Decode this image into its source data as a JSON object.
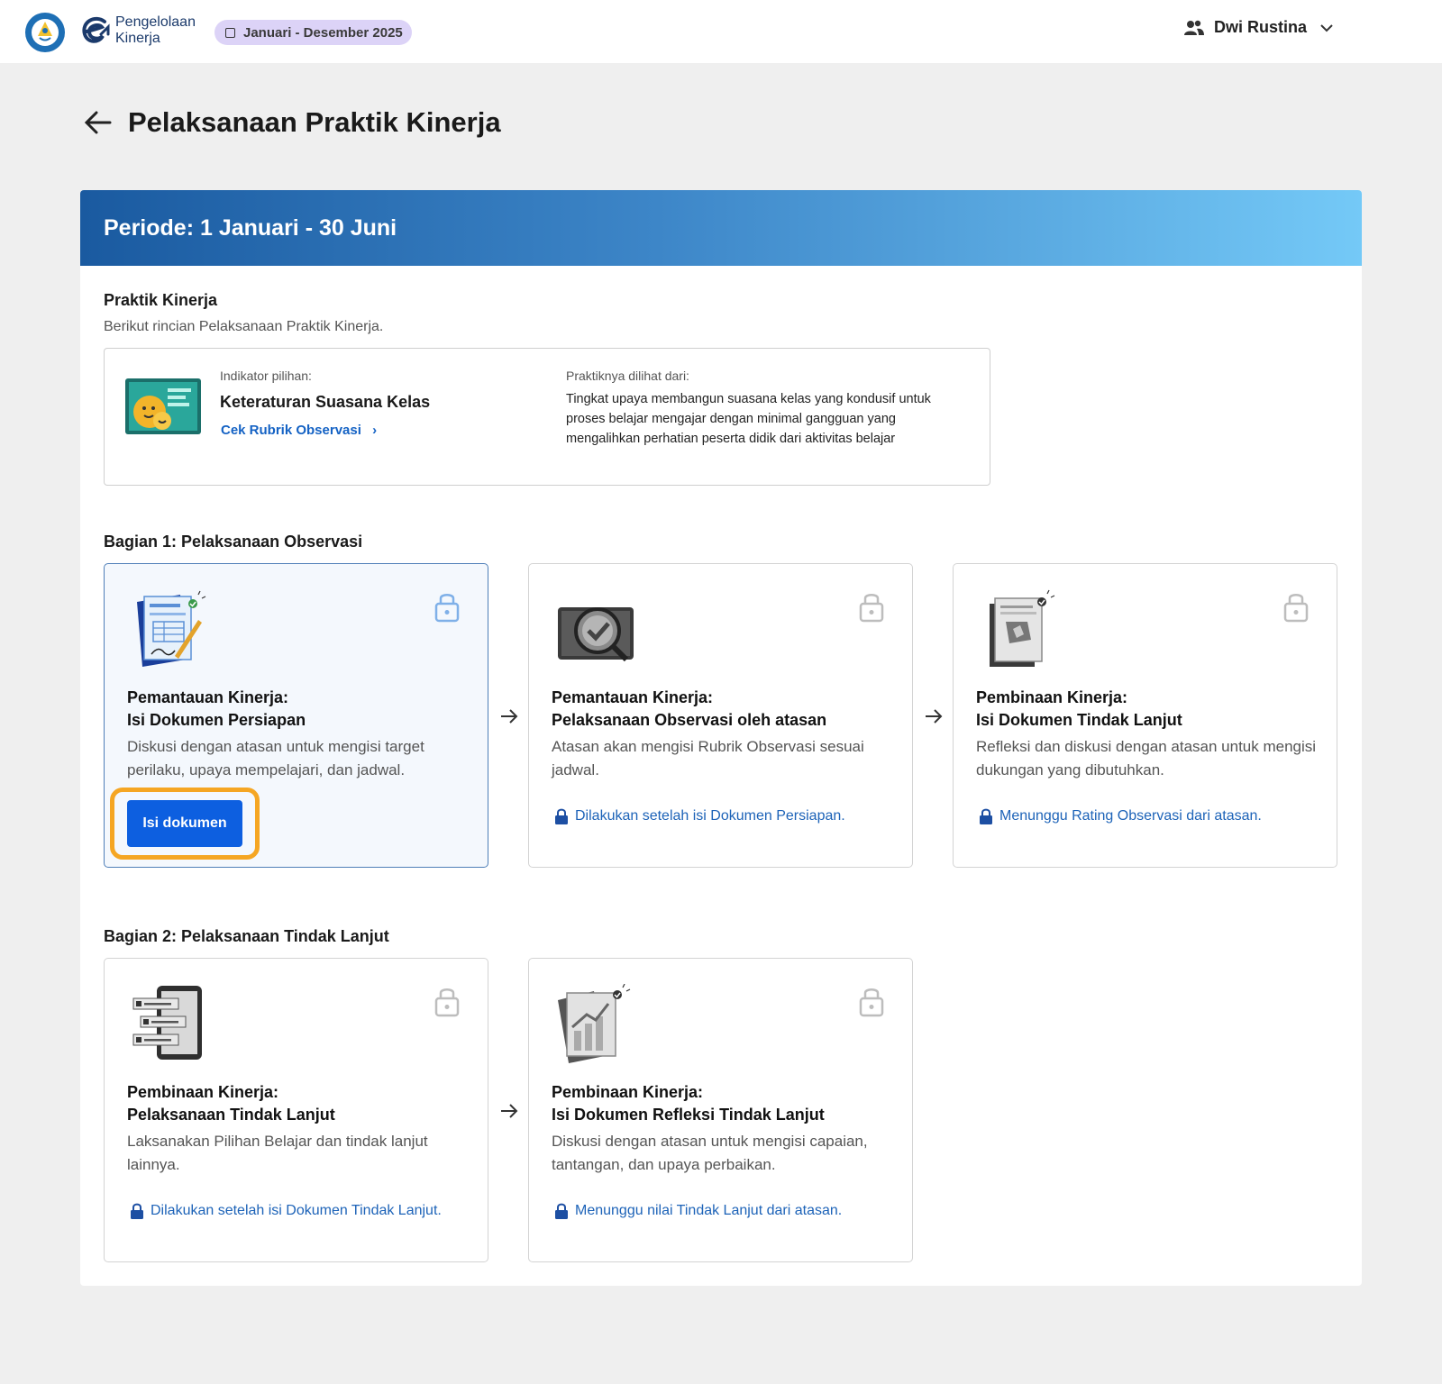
{
  "topbar": {
    "brand_line1": "Pengelolaan",
    "brand_line2": "Kinerja",
    "period": "Januari - Desember 2025",
    "user_name": "Dwi Rustina"
  },
  "page": {
    "title": "Pelaksanaan Praktik Kinerja"
  },
  "banner": {
    "title": "Periode: 1 Januari - 30 Juni"
  },
  "praktik": {
    "title": "Praktik Kinerja",
    "subtitle": "Berikut rincian Pelaksanaan Praktik Kinerja.",
    "indicator_label": "Indikator pilihan:",
    "indicator_name": "Keteraturan Suasana Kelas",
    "rubric_link": "Cek Rubrik Observasi",
    "seen_label": "Praktiknya dilihat dari:",
    "seen_text": "Tingkat upaya membangun suasana kelas yang kondusif untuk proses belajar mengajar dengan minimal gangguan yang mengalihkan perhatian peserta didik dari aktivitas belajar"
  },
  "section1": {
    "title": "Bagian 1: Pelaksanaan Observasi",
    "cards": [
      {
        "title_1": "Pemantauan Kinerja:",
        "title_2": "Isi Dokumen Persiapan",
        "desc": "Diskusi dengan atasan untuk mengisi target perilaku, upaya mempelajari, dan jadwal.",
        "button": "Isi dokumen"
      },
      {
        "title_1": "Pemantauan Kinerja:",
        "title_2": "Pelaksanaan Observasi oleh atasan",
        "desc": "Atasan akan mengisi Rubrik Observasi sesuai jadwal.",
        "note": "Dilakukan setelah isi Dokumen Persiapan."
      },
      {
        "title_1": "Pembinaan Kinerja:",
        "title_2": "Isi Dokumen Tindak Lanjut",
        "desc": "Refleksi dan diskusi dengan atasan untuk mengisi dukungan yang dibutuhkan.",
        "note": "Menunggu Rating Observasi dari atasan."
      }
    ]
  },
  "section2": {
    "title": "Bagian 2: Pelaksanaan Tindak Lanjut",
    "cards": [
      {
        "title_1": "Pembinaan Kinerja:",
        "title_2": "Pelaksanaan Tindak Lanjut",
        "desc": "Laksanakan Pilihan Belajar dan tindak lanjut lainnya.",
        "note": "Dilakukan setelah isi Dokumen Tindak Lanjut."
      },
      {
        "title_1": "Pembinaan Kinerja:",
        "title_2": "Isi Dokumen Refleksi Tindak Lanjut",
        "desc": "Diskusi dengan atasan untuk mengisi capaian, tantangan, dan upaya perbaikan.",
        "note": "Menunggu nilai Tindak Lanjut dari atasan."
      }
    ]
  },
  "colors": {
    "primary": "#0d5fe0",
    "link": "#1d63b8",
    "highlight": "#f5a623",
    "chip": "#dcd3f7"
  }
}
